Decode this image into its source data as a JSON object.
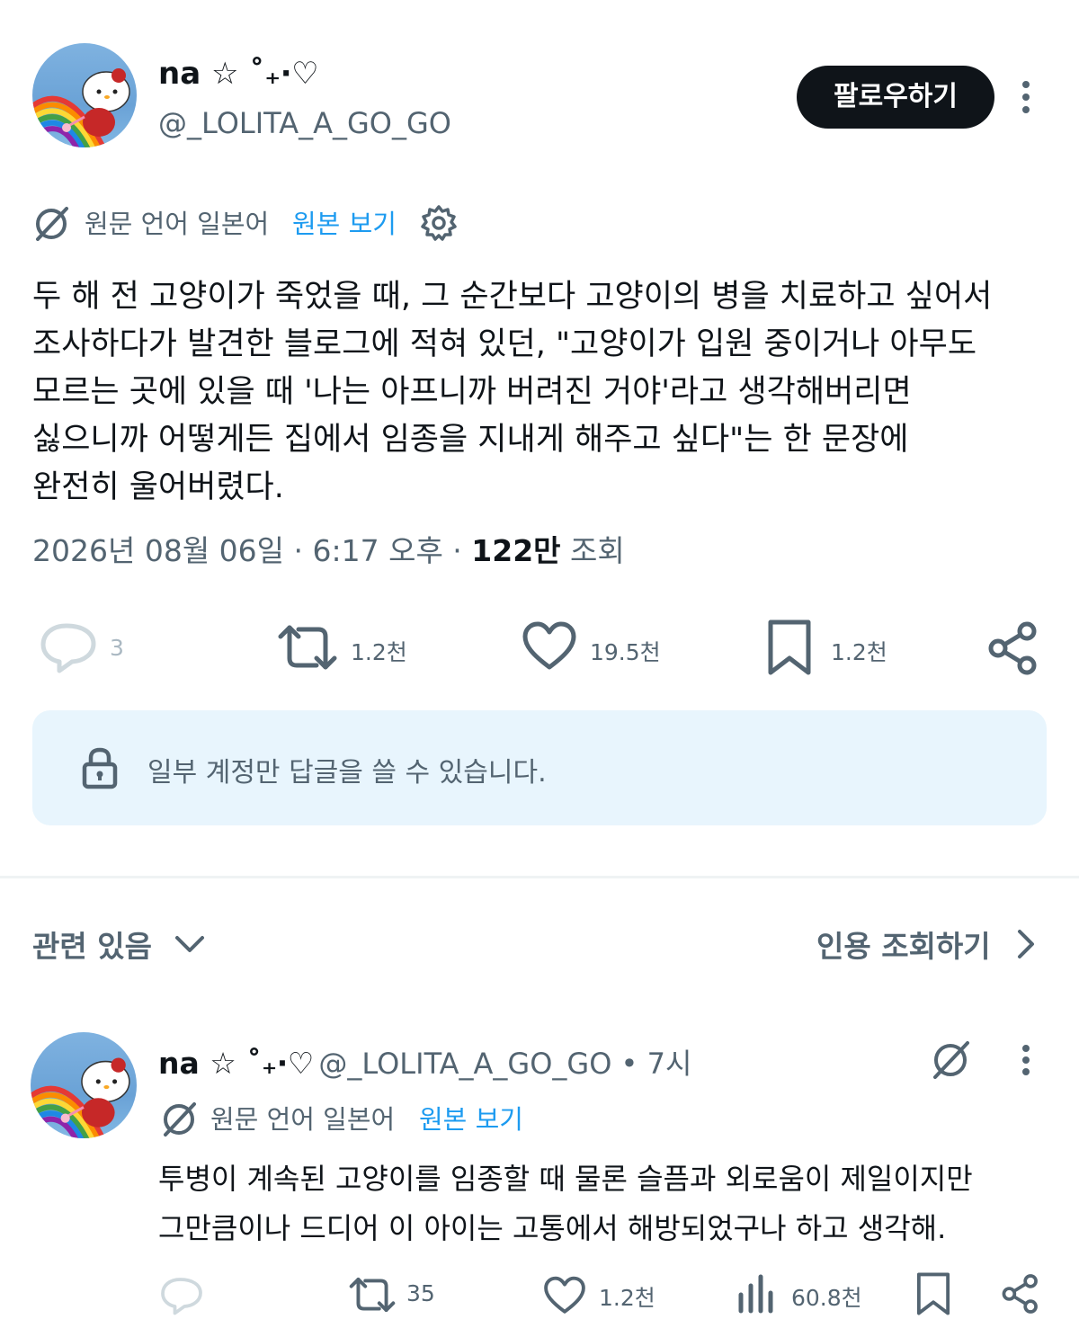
{
  "tweet": {
    "display_name": "na ☆ ˚₊‧♡",
    "handle": "@_LOLITA_A_GO_GO",
    "follow_label": "팔로우하기",
    "translation": {
      "source_label": "원문 언어 일본어",
      "original_link": "원본 보기"
    },
    "body_lines": [
      "두 해 전 고양이가 죽었을 때, 그 순간보다 고양이의 병을 치료하고 싶어서",
      "조사하다가 발견한 블로그에 적혀 있던, \"고양이가 입원 중이거나 아무도",
      "모르는 곳에 있을 때 '나는 아프니까 버려진 거야'라고 생각해버리면",
      "싫으니까 어떻게든 집에서 임종을 지내게 해주고 싶다\"는 한 문장에",
      "완전히 울어버렸다."
    ],
    "timestamp": "2026년 08월 06일 · 6:17 오후 ·",
    "views_count": "122만",
    "views_label": "조회",
    "actions": {
      "replies": "3",
      "reposts": "1.2천",
      "likes": "19.5천",
      "bookmarks": "1.2천"
    },
    "reply_restriction": "일부 계정만 답글을 쓸 수 있습니다."
  },
  "related": {
    "label": "관련 있음",
    "quotes_label": "인용 조회하기"
  },
  "reply": {
    "display_name": "na ☆ ˚₊‧♡",
    "handle_time": "@_LOLITA_A_GO_GO • 7시",
    "translation": {
      "source_label": "원문 언어 일본어",
      "original_link": "원본 보기"
    },
    "body_lines": [
      "투병이 계속된 고양이를 임종할 때 물론 슬픔과 외로움이 제일이지만",
      "그만큼이나 드디어 이 아이는 고통에서 해방되었구나 하고 생각해."
    ],
    "actions": {
      "reposts": "35",
      "likes": "1.2천",
      "views": "60.8천"
    }
  },
  "colors": {
    "text": "#0f1419",
    "secondary": "#536471",
    "link": "#1d9bf0",
    "notice_bg": "#e8f5fd"
  }
}
